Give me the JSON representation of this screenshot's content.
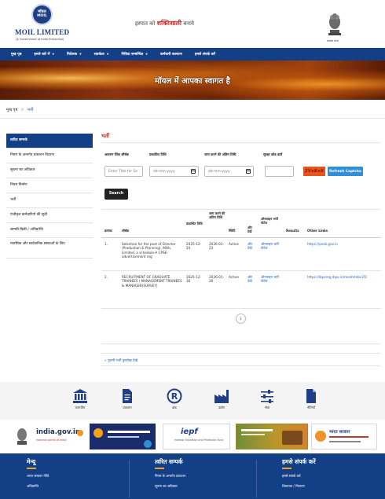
{
  "header": {
    "logo_top": "मॉयल",
    "logo_bottom": "MOIL",
    "org_name": "MOIL LIMITED",
    "org_sub": "(A Government of India Enterprise)",
    "tagline_pre": "इस्पात को",
    "tagline_highlight": "शक्तिशाली",
    "tagline_post": "बनाये",
    "emblem_caption": "सत्यमेव जयते"
  },
  "nav": {
    "items": [
      {
        "label": "मुख पृष्ठ",
        "dropdown": false
      },
      {
        "label": "हमारे बारे में",
        "dropdown": true
      },
      {
        "label": "निवेशक",
        "dropdown": true
      },
      {
        "label": "सतर्कता",
        "dropdown": true
      },
      {
        "label": "निविदा सम्बन्धित",
        "dropdown": true
      },
      {
        "label": "कर्मचारी कल्याण",
        "dropdown": false
      },
      {
        "label": "हमसे संपर्क करें",
        "dropdown": false
      }
    ]
  },
  "banner": {
    "text": "मॉयल में आपका स्वागत है"
  },
  "breadcrumb": {
    "home": "मुख पृष्ठ",
    "separator": ">",
    "current": "भर्ती"
  },
  "sidebar": {
    "items": [
      "त्वरित सम्पर्क",
      "नियम के अन्तर्गत प्रकाशन विवरण",
      "सूचना का अधिकार",
      "नियम निर्माण",
      "भर्ती",
      "पंजीकृत कर्मचारियों की सूची",
      "सामग्री बिक्री / अधिप्राप्ति",
      "मानसिक और सार्वजनिक संस्थाओं के लिए"
    ]
  },
  "main": {
    "title": "भर्ती",
    "filters": {
      "title_label": "आवरण लिंक शीर्षक",
      "pub_date_label": "प्रकाशित तिथि",
      "last_date_label": "जमा करने की अंतिम तिथि",
      "captcha_label": "सुरक्षा कोड डालें",
      "title_placeholder": "Enter Title for Se",
      "date_placeholder": "dd-mm-yyyy",
      "captcha_text": "2VsBx8",
      "refresh_label": "Refresh Captcha",
      "search_label": "Search"
    },
    "table": {
      "headers": [
        "क्रमांक",
        "शीर्षक",
        "प्रकाशित तिथि",
        "जमा करने की अंतिम तिथि",
        "स्थिति",
        "और देखें",
        "ऑनलाइन भर्ती पोर्टल",
        "Results",
        "Other Links"
      ],
      "rows": [
        {
          "sno": "1.",
          "title": "Selection for the post of Director (Production & Planning), MOIL Limited, a schedule-A CPSE- advertisement reg",
          "pub_date": "2025-12-24",
          "last_date": "2026-01-23",
          "status": "Active",
          "more": "और देखें",
          "portal": "ऑनलाइन भर्ती पोर्टल",
          "results": "",
          "other_link": "https://pesb.gov.in"
        },
        {
          "sno": "2.",
          "title": "RECRUITMENT OF GRADUATE TRAINEES / MANAGEMENT TRAINEES & MANAGER(SURVEY)",
          "pub_date": "2025-12-30",
          "last_date": "2026-01-20",
          "status": "Active",
          "more": "और देखें",
          "portal": "ऑनलाइन भर्ती पोर्टल",
          "results": "",
          "other_link": "https://ibpsreg.ibps.in/moilmtdec25/"
        }
      ],
      "page": "1"
    },
    "old_link": "» पुरानी भर्ती पुरालेख देखें"
  },
  "quick_icons": [
    {
      "icon": "bank-icon",
      "label": "कारपोरेट"
    },
    {
      "icon": "document-icon",
      "label": "प्रकाशन"
    },
    {
      "icon": "registered-icon",
      "label": "ब्रांड"
    },
    {
      "icon": "factory-icon",
      "label": "उद्योग"
    },
    {
      "icon": "sliders-icon",
      "label": "सेवा"
    },
    {
      "icon": "file-icon",
      "label": "नीतियाँ"
    }
  ],
  "partners": [
    {
      "name": "emblem-logo",
      "text": "",
      "sub": ""
    },
    {
      "name": "india-gov-logo",
      "text": "india.gov.in",
      "sub": "national portal of india"
    },
    {
      "name": "portal-logo",
      "text": "",
      "sub": ""
    },
    {
      "name": "iepf-logo",
      "text": "iepf",
      "sub": "Investor Education and Protection Fund"
    },
    {
      "name": "scheme-logo",
      "text": "",
      "sub": ""
    },
    {
      "name": "bharat-logo",
      "text": "भारत सरकार",
      "sub": ""
    }
  ],
  "footer": {
    "col1": {
      "heading": "मेन्यू",
      "links": [
        "भारत सरकार नीति",
        "अधिप्राप्ति"
      ]
    },
    "col2": {
      "heading": "त्वरित सम्पर्क",
      "links": [
        "नियम के अन्तर्गत प्रकाशन",
        "सूचना का अधिकार"
      ]
    },
    "col3": {
      "heading": "हमसे संपर्क करें",
      "links": [
        "हमसे संपर्क करें",
        "शिकायत / निवारण"
      ]
    }
  },
  "colors": {
    "brand_blue": "#133f86",
    "title_red": "#c0392b",
    "captcha_orange": "#e8541b",
    "refresh_blue": "#2f8fd8",
    "accent_orange": "#f3a21a"
  }
}
